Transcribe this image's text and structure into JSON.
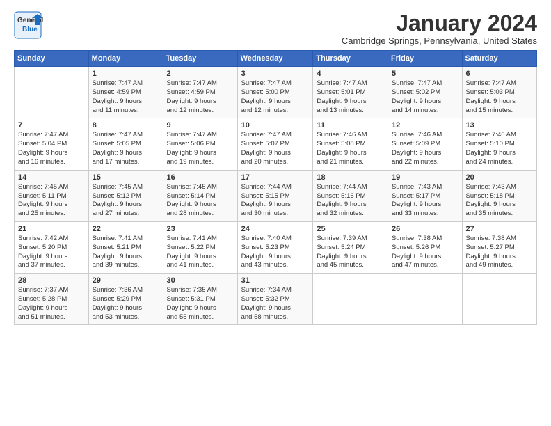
{
  "logo": {
    "general": "General",
    "blue": "Blue"
  },
  "header": {
    "month_title": "January 2024",
    "location": "Cambridge Springs, Pennsylvania, United States"
  },
  "days_of_week": [
    "Sunday",
    "Monday",
    "Tuesday",
    "Wednesday",
    "Thursday",
    "Friday",
    "Saturday"
  ],
  "weeks": [
    [
      {
        "day": "",
        "info": ""
      },
      {
        "day": "1",
        "info": "Sunrise: 7:47 AM\nSunset: 4:59 PM\nDaylight: 9 hours\nand 11 minutes."
      },
      {
        "day": "2",
        "info": "Sunrise: 7:47 AM\nSunset: 4:59 PM\nDaylight: 9 hours\nand 12 minutes."
      },
      {
        "day": "3",
        "info": "Sunrise: 7:47 AM\nSunset: 5:00 PM\nDaylight: 9 hours\nand 12 minutes."
      },
      {
        "day": "4",
        "info": "Sunrise: 7:47 AM\nSunset: 5:01 PM\nDaylight: 9 hours\nand 13 minutes."
      },
      {
        "day": "5",
        "info": "Sunrise: 7:47 AM\nSunset: 5:02 PM\nDaylight: 9 hours\nand 14 minutes."
      },
      {
        "day": "6",
        "info": "Sunrise: 7:47 AM\nSunset: 5:03 PM\nDaylight: 9 hours\nand 15 minutes."
      }
    ],
    [
      {
        "day": "7",
        "info": "Sunrise: 7:47 AM\nSunset: 5:04 PM\nDaylight: 9 hours\nand 16 minutes."
      },
      {
        "day": "8",
        "info": "Sunrise: 7:47 AM\nSunset: 5:05 PM\nDaylight: 9 hours\nand 17 minutes."
      },
      {
        "day": "9",
        "info": "Sunrise: 7:47 AM\nSunset: 5:06 PM\nDaylight: 9 hours\nand 19 minutes."
      },
      {
        "day": "10",
        "info": "Sunrise: 7:47 AM\nSunset: 5:07 PM\nDaylight: 9 hours\nand 20 minutes."
      },
      {
        "day": "11",
        "info": "Sunrise: 7:46 AM\nSunset: 5:08 PM\nDaylight: 9 hours\nand 21 minutes."
      },
      {
        "day": "12",
        "info": "Sunrise: 7:46 AM\nSunset: 5:09 PM\nDaylight: 9 hours\nand 22 minutes."
      },
      {
        "day": "13",
        "info": "Sunrise: 7:46 AM\nSunset: 5:10 PM\nDaylight: 9 hours\nand 24 minutes."
      }
    ],
    [
      {
        "day": "14",
        "info": "Sunrise: 7:45 AM\nSunset: 5:11 PM\nDaylight: 9 hours\nand 25 minutes."
      },
      {
        "day": "15",
        "info": "Sunrise: 7:45 AM\nSunset: 5:12 PM\nDaylight: 9 hours\nand 27 minutes."
      },
      {
        "day": "16",
        "info": "Sunrise: 7:45 AM\nSunset: 5:14 PM\nDaylight: 9 hours\nand 28 minutes."
      },
      {
        "day": "17",
        "info": "Sunrise: 7:44 AM\nSunset: 5:15 PM\nDaylight: 9 hours\nand 30 minutes."
      },
      {
        "day": "18",
        "info": "Sunrise: 7:44 AM\nSunset: 5:16 PM\nDaylight: 9 hours\nand 32 minutes."
      },
      {
        "day": "19",
        "info": "Sunrise: 7:43 AM\nSunset: 5:17 PM\nDaylight: 9 hours\nand 33 minutes."
      },
      {
        "day": "20",
        "info": "Sunrise: 7:43 AM\nSunset: 5:18 PM\nDaylight: 9 hours\nand 35 minutes."
      }
    ],
    [
      {
        "day": "21",
        "info": "Sunrise: 7:42 AM\nSunset: 5:20 PM\nDaylight: 9 hours\nand 37 minutes."
      },
      {
        "day": "22",
        "info": "Sunrise: 7:41 AM\nSunset: 5:21 PM\nDaylight: 9 hours\nand 39 minutes."
      },
      {
        "day": "23",
        "info": "Sunrise: 7:41 AM\nSunset: 5:22 PM\nDaylight: 9 hours\nand 41 minutes."
      },
      {
        "day": "24",
        "info": "Sunrise: 7:40 AM\nSunset: 5:23 PM\nDaylight: 9 hours\nand 43 minutes."
      },
      {
        "day": "25",
        "info": "Sunrise: 7:39 AM\nSunset: 5:24 PM\nDaylight: 9 hours\nand 45 minutes."
      },
      {
        "day": "26",
        "info": "Sunrise: 7:38 AM\nSunset: 5:26 PM\nDaylight: 9 hours\nand 47 minutes."
      },
      {
        "day": "27",
        "info": "Sunrise: 7:38 AM\nSunset: 5:27 PM\nDaylight: 9 hours\nand 49 minutes."
      }
    ],
    [
      {
        "day": "28",
        "info": "Sunrise: 7:37 AM\nSunset: 5:28 PM\nDaylight: 9 hours\nand 51 minutes."
      },
      {
        "day": "29",
        "info": "Sunrise: 7:36 AM\nSunset: 5:29 PM\nDaylight: 9 hours\nand 53 minutes."
      },
      {
        "day": "30",
        "info": "Sunrise: 7:35 AM\nSunset: 5:31 PM\nDaylight: 9 hours\nand 55 minutes."
      },
      {
        "day": "31",
        "info": "Sunrise: 7:34 AM\nSunset: 5:32 PM\nDaylight: 9 hours\nand 58 minutes."
      },
      {
        "day": "",
        "info": ""
      },
      {
        "day": "",
        "info": ""
      },
      {
        "day": "",
        "info": ""
      }
    ]
  ]
}
